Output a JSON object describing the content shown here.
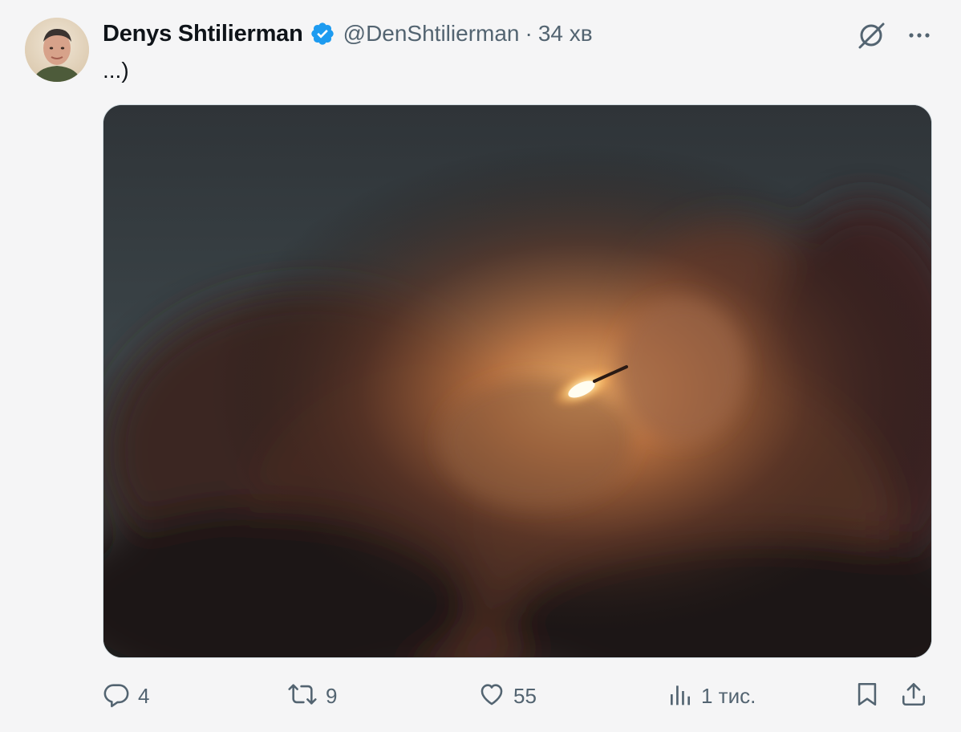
{
  "author": {
    "display_name": "Denys Shtilierman",
    "handle": "@DenShtilierman",
    "separator": "·",
    "time": "34 хв",
    "verified": true
  },
  "tweet": {
    "text": "...)"
  },
  "header_icons": {
    "grok": "grok-slash-icon",
    "more": "more-dots-icon"
  },
  "actions": {
    "reply_count": "4",
    "retweet_count": "9",
    "like_count": "55",
    "views_count": "1 тис."
  },
  "colors": {
    "verified": "#1d9bf0",
    "secondary_text": "#536471",
    "background": "#f5f5f6"
  }
}
